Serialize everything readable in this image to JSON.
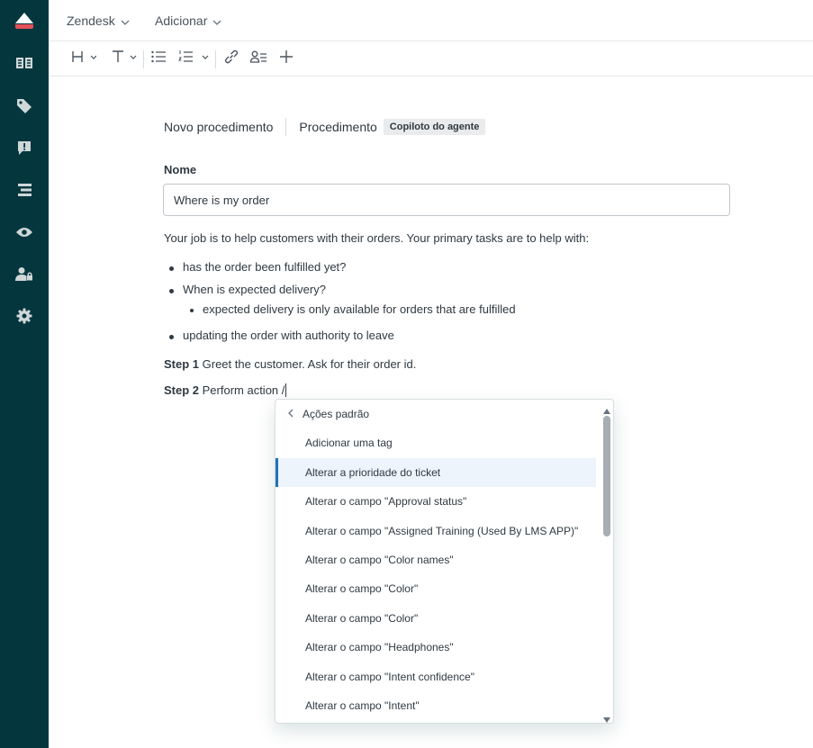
{
  "colors": {
    "sidebar_bg": "#03363d",
    "accent_logo": "#e34f5a",
    "active_item": "#edf4fb",
    "active_border": "#1f73b7"
  },
  "sidebar": {
    "items": [
      {
        "icon": "zendesk-logo-icon"
      },
      {
        "icon": "knowledge-book-icon"
      },
      {
        "icon": "tag-icon"
      },
      {
        "icon": "alert-message-icon"
      },
      {
        "icon": "layers-icon"
      },
      {
        "icon": "eye-icon"
      },
      {
        "icon": "user-lock-icon"
      },
      {
        "icon": "gear-icon"
      }
    ]
  },
  "topbar": {
    "menu1": "Zendesk",
    "menu2": "Adicionar"
  },
  "toolbar": {
    "buttons": [
      "heading-icon",
      "text-icon",
      "bulleted-list-icon",
      "numbered-list-icon",
      "link-icon",
      "user-list-icon",
      "plus-icon"
    ]
  },
  "breadcrumb": {
    "item1": "Novo procedimento",
    "item2": "Procedimento",
    "badge": "Copiloto do agente"
  },
  "form": {
    "name_label": "Nome",
    "name_value": "Where is my order"
  },
  "content": {
    "intro": "Your job is to help customers with their orders. Your primary tasks are to help with:",
    "bullet1": "has the order been fulfilled yet?",
    "bullet2": "When is expected delivery?",
    "sub_bullet": "expected delivery is only available for orders that are fulfilled",
    "bullet3": "updating the order with authority to leave",
    "step1_label": "Step 1",
    "step1_text": " Greet the customer. Ask for their order id.",
    "step2_label": "Step 2",
    "step2_text": " Perform action /"
  },
  "dropdown": {
    "header": "Ações padrão",
    "items": [
      "Adicionar uma tag",
      "Alterar a prioridade do ticket",
      "Alterar o campo \"Approval status\"",
      "Alterar o campo \"Assigned Training (Used By LMS APP)\"",
      "Alterar o campo \"Color names\"",
      "Alterar o campo \"Color\"",
      "Alterar o campo \"Color\"",
      "Alterar o campo \"Headphones\"",
      "Alterar o campo \"Intent confidence\"",
      "Alterar o campo \"Intent\""
    ],
    "active_index": 1
  }
}
